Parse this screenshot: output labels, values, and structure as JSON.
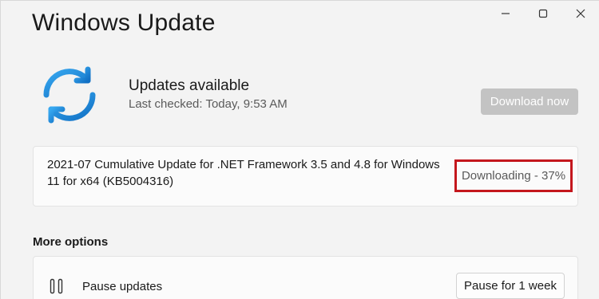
{
  "window": {
    "controls": [
      "minimize-icon",
      "maximize-icon",
      "close-icon"
    ]
  },
  "page": {
    "title": "Windows Update"
  },
  "status": {
    "icon": "sync-icon",
    "title": "Updates available",
    "last_checked": "Last checked: Today, 9:53 AM",
    "download_button": "Download now"
  },
  "update": {
    "name": "2021-07 Cumulative Update for .NET Framework 3.5 and 4.8 for Windows 11 for x64 (KB5004316)",
    "progress_text": "Downloading - 37%",
    "progress_percent": 37
  },
  "more_options": {
    "title": "More options",
    "items": [
      {
        "icon": "pause-icon",
        "label": "Pause updates",
        "button": "Pause for 1 week"
      }
    ]
  },
  "colors": {
    "background": "#f3f3f3",
    "card": "#fbfbfb",
    "accent_blue": "#1a87d8",
    "highlight_red": "#c4171d",
    "disabled_button": "#c3c3c3"
  }
}
